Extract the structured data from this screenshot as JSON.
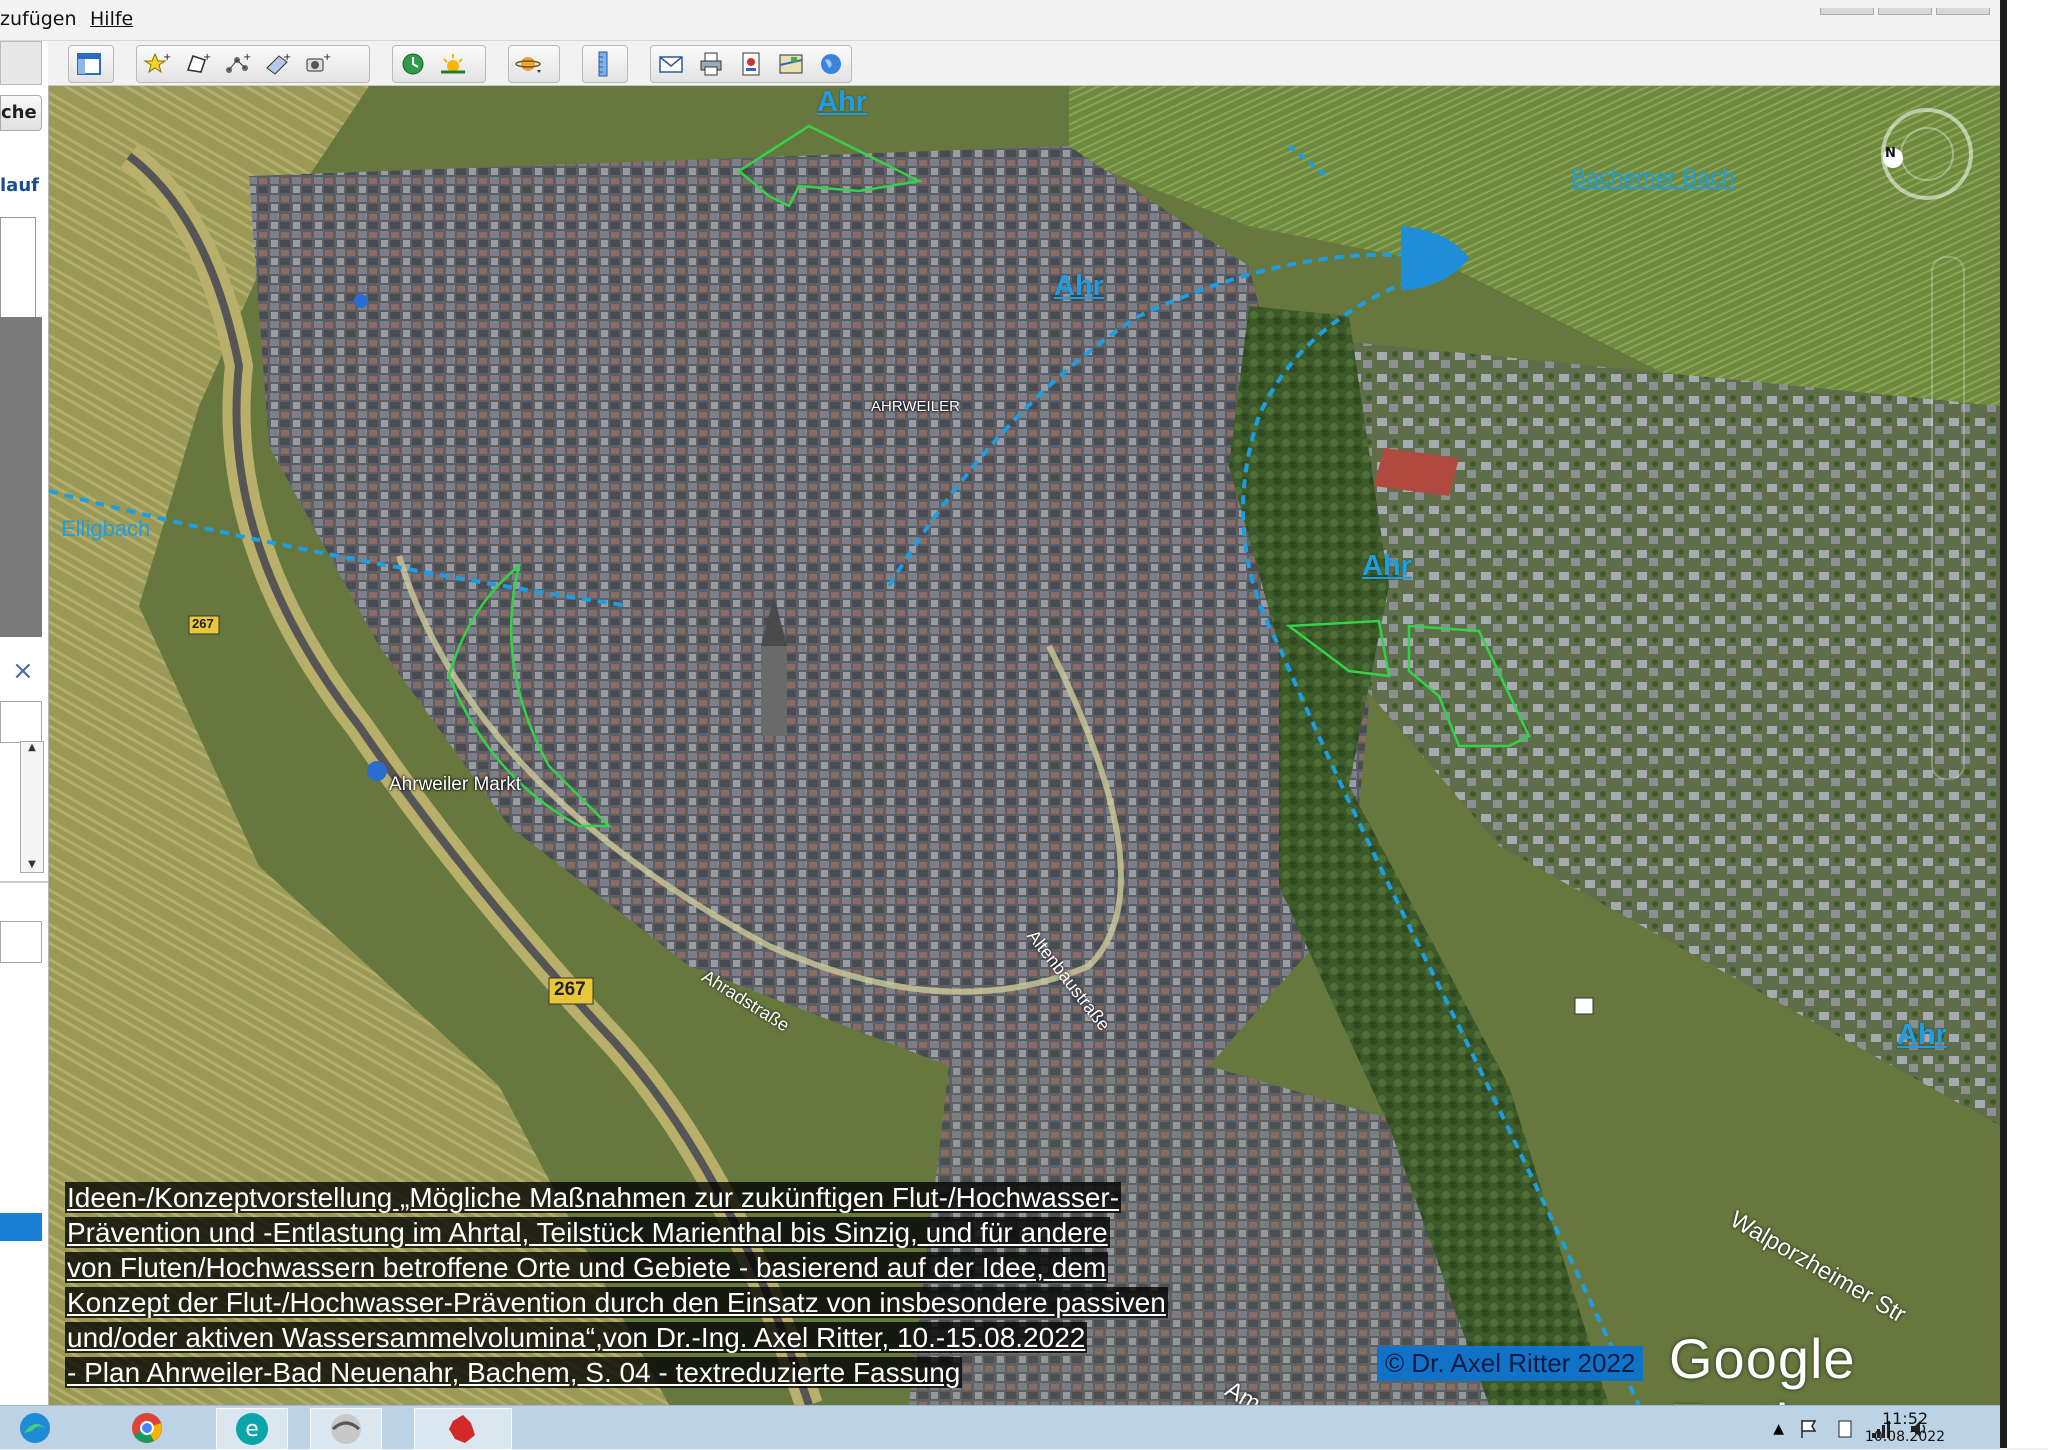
{
  "menu": {
    "items": [
      {
        "label": "zufügen"
      },
      {
        "label": "Hilfe"
      }
    ]
  },
  "left_panel": {
    "search_label": "che",
    "history_label": "lauf",
    "close_symbol": "×"
  },
  "toolbar": {
    "icons": [
      "sidebar-toggle-icon",
      "add-placemark-icon",
      "add-polygon-icon",
      "add-path-icon",
      "add-overlay-icon",
      "record-tour-icon",
      "historical-imagery-icon",
      "sunlight-icon",
      "planets-icon",
      "ruler-icon",
      "email-icon",
      "print-icon",
      "save-image-icon",
      "view-in-maps-icon",
      "earth-icon"
    ]
  },
  "map": {
    "labels": {
      "ahr_top": "Ahr",
      "ahr_mid": "Ahr",
      "ahr_center": "Ahr",
      "ahr_right": "Ahr",
      "bachemer_bach": "Bachemer Bach",
      "elligbach": "Elligbach",
      "ahrweiler": "AHRWEILER",
      "ahrweiler_markt": "Ahrweiler Markt",
      "road_267_a": "267",
      "road_267_b": "267",
      "street_altenbaustrasse": "Altenbaustraße",
      "street_adenbachstrasse": "Ahradstraße",
      "street_walporzheimer": "Walporzheimer Str",
      "street_am": "Am"
    },
    "caption": [
      "Ideen-/Konzeptvorstellung „Mögliche Maßnahmen zur zukünftigen Flut-/Hochwasser-",
      "Prävention und -Entlastung im Ahrtal, Teilstück Marienthal bis Sinzig, und für andere",
      "von Fluten/Hochwassern betroffene Orte und Gebiete - basierend auf der Idee, dem",
      "Konzept der Flut-/Hochwasser-Prävention durch den Einsatz von insbesondere passiven",
      "und/oder aktiven Wassersammelvolumina“,von Dr.-Ing. Axel Ritter, 10.-15.08.2022",
      "- Plan Ahrweiler-Bad Neuenahr, Bachem, S. 04 - textreduzierte Fassung"
    ],
    "copyright": "© Dr. Axel Ritter 2022",
    "logo": "Google Earth",
    "compass_letter": "N"
  },
  "taskbar": {
    "apps": [
      "edge-icon",
      "chrome-icon",
      "eset-icon",
      "google-earth-icon",
      "app-red-icon"
    ],
    "time": "11:52",
    "date": "10.08.2022"
  },
  "colors": {
    "river_blue": "#1e9ee0",
    "polygon_green": "#33d24a",
    "menu_bg": "#f3f3f3",
    "taskbar_bg": "#bcd3e6"
  }
}
